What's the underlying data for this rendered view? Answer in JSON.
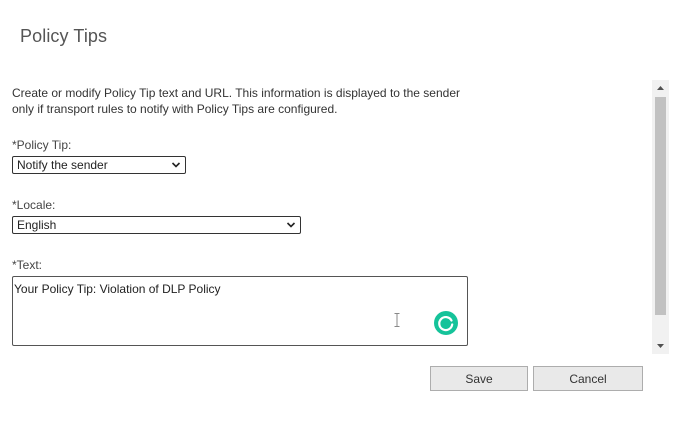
{
  "dialog": {
    "title": "Policy Tips",
    "description": "Create or modify Policy Tip text and URL. This information is displayed to the sender only if transport rules to notify with Policy Tips are configured."
  },
  "form": {
    "policy_tip": {
      "label": "*Policy Tip:",
      "selected": "Notify the sender"
    },
    "locale": {
      "label": "*Locale:",
      "selected": "English"
    },
    "text": {
      "label": "*Text:",
      "value": "Your Policy Tip: Violation of DLP Policy"
    }
  },
  "buttons": {
    "save": "Save",
    "cancel": "Cancel"
  },
  "icons": {
    "grammarly": "grammarly-icon",
    "ibeam": "text-cursor-icon"
  },
  "colors": {
    "grammarly": "#15c39a",
    "button_bg": "#e9e9e9",
    "scroll_thumb": "#c1c1c1"
  }
}
